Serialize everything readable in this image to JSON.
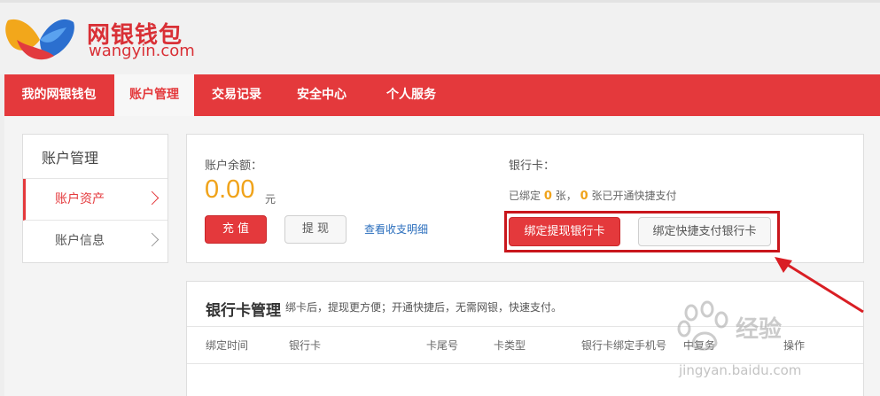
{
  "header": {
    "logo_cn": "网银钱包",
    "logo_en": "wangyin.com"
  },
  "nav": {
    "items": [
      {
        "label": "我的网银钱包",
        "active": false
      },
      {
        "label": "账户管理",
        "active": true
      },
      {
        "label": "交易记录",
        "active": false
      },
      {
        "label": "安全中心",
        "active": false
      },
      {
        "label": "个人服务",
        "active": false
      }
    ]
  },
  "sidebar": {
    "title": "账户管理",
    "items": [
      {
        "label": "账户资产",
        "active": true
      },
      {
        "label": "账户信息",
        "active": false
      }
    ]
  },
  "account": {
    "balance_label": "账户余额：",
    "balance_amount": "0.00",
    "balance_unit": "元",
    "recharge_label": "充 值",
    "withdraw_label": "提 现",
    "detail_link": "查看收支明细"
  },
  "bank_card": {
    "label": "银行卡：",
    "status_prefix": "已绑定",
    "bound_count": "0",
    "status_mid": "张，",
    "quick_count": "0",
    "status_suffix": "张已开通快捷支付",
    "bind_withdraw_label": "绑定提现银行卡",
    "bind_quick_label": "绑定快捷支付银行卡"
  },
  "card_manage": {
    "title": "银行卡管理",
    "description": "绑卡后，提现更方便；开通快捷后，无需网银，快速支付。",
    "columns": [
      "绑定时间",
      "银行卡",
      "卡尾号",
      "卡类型",
      "银行卡绑定手机号",
      "中复务",
      "操作"
    ]
  },
  "watermark": {
    "text": "经验",
    "url": "jingyan.baidu.com"
  },
  "colors": {
    "brand_red": "#e4393c",
    "amount_orange": "#f0a31a",
    "highlight_red": "#c9161c",
    "link_blue": "#2a6ebd"
  }
}
